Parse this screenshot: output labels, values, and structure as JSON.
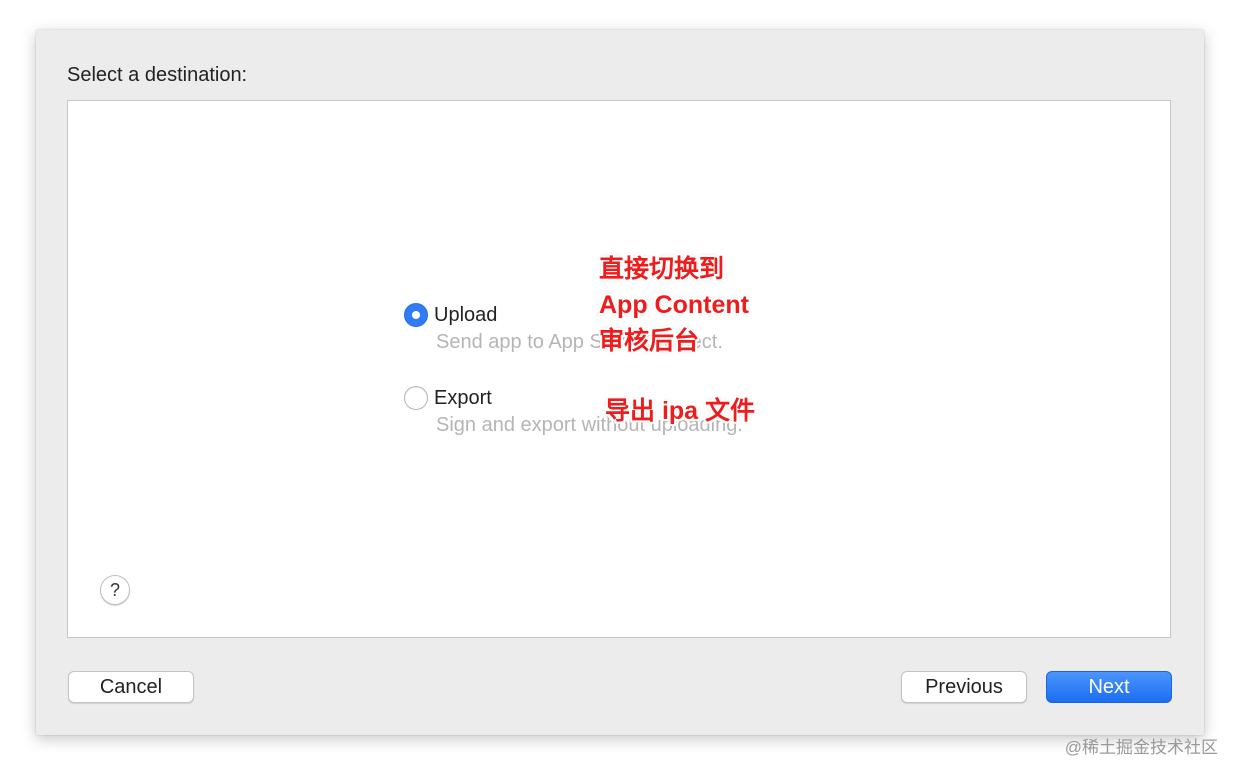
{
  "dialog": {
    "heading": "Select a destination:",
    "options": [
      {
        "label": "Upload",
        "description": "Send app to App Store Connect.",
        "selected": true
      },
      {
        "label": "Export",
        "description": "Sign and export without uploading.",
        "selected": false
      }
    ],
    "help_label": "?",
    "buttons": {
      "cancel": "Cancel",
      "previous": "Previous",
      "next": "Next"
    }
  },
  "annotations": {
    "upload_lines": [
      "直接切换到",
      "App Content",
      "审核后台"
    ],
    "export_note": "导出 ipa 文件"
  },
  "watermark": "@稀土掘金技术社区",
  "colors": {
    "accent": "#2f7cf6",
    "annotation": "#ee1c1c",
    "dialog_background": "#ececec"
  }
}
